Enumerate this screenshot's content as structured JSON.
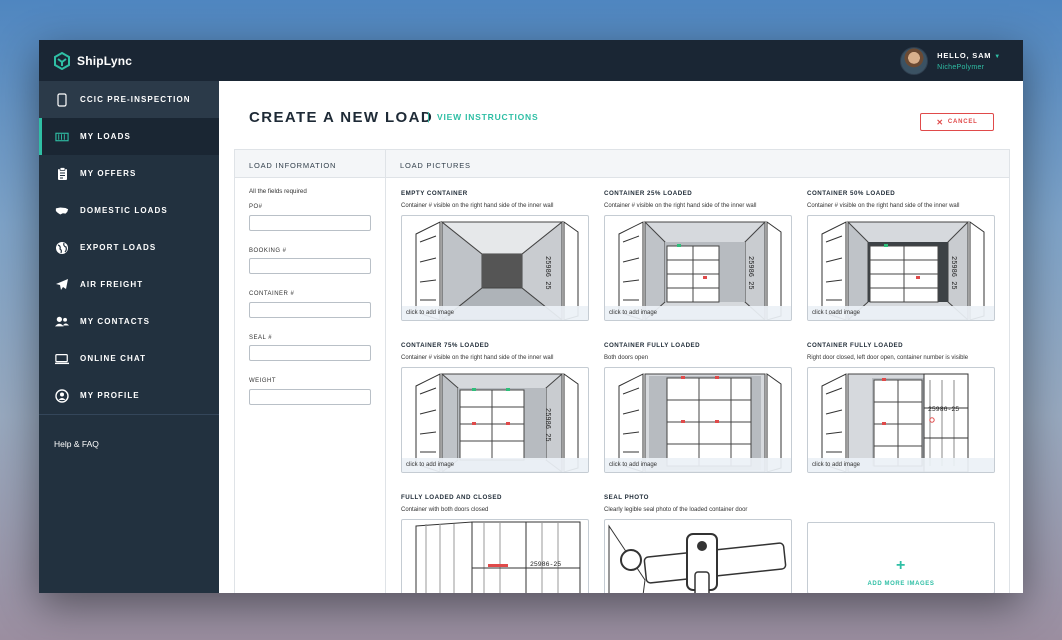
{
  "brand": {
    "name": "ShipLync",
    "accent": "#2fbfa5",
    "bg_dark": "#1a2634"
  },
  "user": {
    "greeting": "HELLO, SAM",
    "company": "NichePolymer"
  },
  "sidebar": {
    "items": [
      {
        "label": "CCIC PRE-INSPECTION",
        "icon": "phone-icon"
      },
      {
        "label": "MY LOADS",
        "icon": "container-icon"
      },
      {
        "label": "MY OFFERS",
        "icon": "clipboard-icon"
      },
      {
        "label": "DOMESTIC LOADS",
        "icon": "usa-map-icon"
      },
      {
        "label": "EXPORT LOADS",
        "icon": "globe-icon"
      },
      {
        "label": "AIR FREIGHT",
        "icon": "plane-icon"
      },
      {
        "label": "MY CONTACTS",
        "icon": "users-icon"
      },
      {
        "label": "ONLINE CHAT",
        "icon": "chat-icon"
      },
      {
        "label": "MY PROFILE",
        "icon": "profile-icon"
      }
    ],
    "active": "MY LOADS",
    "help": "Help & FAQ"
  },
  "main": {
    "title": "CREATE A NEW LOAD",
    "instructions": "VIEW INSTRUCTIONS",
    "cancel": "CANCEL",
    "info_header": "LOAD INFORMATION",
    "pictures_header": "LOAD PICTURES",
    "required_note": "All the fields required",
    "fields": [
      {
        "label": "PO#",
        "value": ""
      },
      {
        "label": "BOOKING #",
        "value": ""
      },
      {
        "label": "CONTAINER #",
        "value": ""
      },
      {
        "label": "SEAL #",
        "value": ""
      },
      {
        "label": "WEIGHT",
        "value": ""
      }
    ],
    "pictures": [
      {
        "title": "EMPTY CONTAINER",
        "desc": "Container # visible on the right hand side of the inner wall",
        "cta": "click to add image"
      },
      {
        "title": "CONTAINER 25% LOADED",
        "desc": "Container # visible on the right hand side of the inner wall",
        "cta": "click to add image"
      },
      {
        "title": "CONTAINER 50% LOADED",
        "desc": "Container # visible on the right hand side of the inner wall",
        "cta": "click t oadd image"
      },
      {
        "title": "CONTAINER 75% LOADED",
        "desc": "Container # visible on the right hand side of the inner wall",
        "cta": "click to add image"
      },
      {
        "title": "CONTAINER FULLY LOADED",
        "desc": "Both doors open",
        "cta": "click to add image"
      },
      {
        "title": "CONTAINER FULLY LOADED",
        "desc": "Right door closed, left door open, container number is visible",
        "cta": "click to add image"
      },
      {
        "title": "FULLY LOADED AND CLOSED",
        "desc": "Container with both doors closed",
        "cta": ""
      },
      {
        "title": "SEAL PHOTO",
        "desc": "Clearly legible seal photo of the loaded container door",
        "cta": ""
      }
    ],
    "container_number_vertical": "25986 25",
    "container_number": "25986-25",
    "add_more": "ADD MORE IMAGES"
  }
}
